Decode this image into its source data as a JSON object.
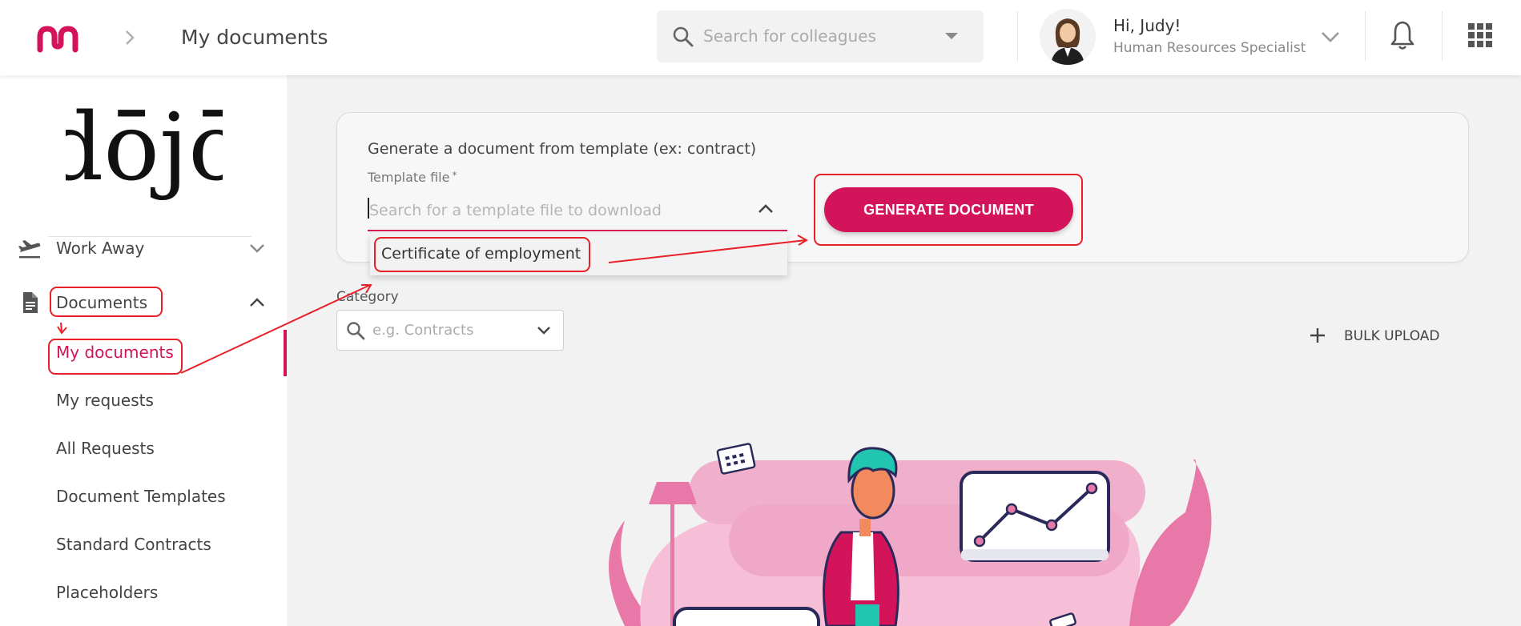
{
  "header": {
    "page_title": "My documents",
    "search_placeholder": "Search for colleagues",
    "user_greeting": "Hi, Judy!",
    "user_role": "Human Resources Specialist",
    "brand_color": "#d3135a"
  },
  "sidebar": {
    "brand_name": "dōjō",
    "sections": [
      {
        "label": "Work Away",
        "icon": "airplane-departure-icon",
        "expanded": false
      },
      {
        "label": "Documents",
        "icon": "document-icon",
        "expanded": true
      }
    ],
    "document_items": [
      {
        "label": "My documents",
        "active": true
      },
      {
        "label": "My requests",
        "active": false
      },
      {
        "label": "All Requests",
        "active": false
      },
      {
        "label": "Document Templates",
        "active": false
      },
      {
        "label": "Standard Contracts",
        "active": false
      },
      {
        "label": "Placeholders",
        "active": false
      }
    ]
  },
  "generate": {
    "title": "Generate a document from template (ex: contract)",
    "template_label": "Template file",
    "required_mark": "*",
    "template_placeholder": "Search for a template file to download",
    "options": [
      "Certificate of employment"
    ],
    "button_label": "GENERATE DOCUMENT"
  },
  "category": {
    "label": "Category",
    "placeholder": "e.g. Contracts"
  },
  "bulk_upload_label": "BULK UPLOAD",
  "annotation_color": "#e8202a"
}
